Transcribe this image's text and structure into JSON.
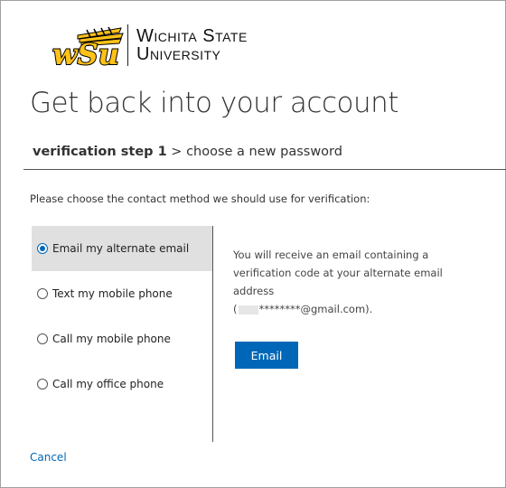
{
  "brand": {
    "logo_mark": "wSu",
    "name_line1": "Wichita State",
    "name_line2": "University",
    "colors": {
      "gold": "#FFC217",
      "black": "#000000"
    }
  },
  "page": {
    "title": "Get back into your account",
    "step_current": "verification step 1",
    "step_separator": " > ",
    "step_next": "choose a new password",
    "prompt": "Please choose the contact method we should use for verification:"
  },
  "options": [
    {
      "label": "Email my alternate email",
      "selected": true
    },
    {
      "label": "Text my mobile phone",
      "selected": false
    },
    {
      "label": "Call my mobile phone",
      "selected": false
    },
    {
      "label": "Call my office phone",
      "selected": false
    }
  ],
  "detail": {
    "line1": "You will receive an email containing a verification code at your alternate email address",
    "email_open": "(",
    "email_masked": "********@gmail.com",
    "email_close": ")."
  },
  "actions": {
    "email_button": "Email",
    "cancel_link": "Cancel"
  },
  "colors": {
    "accent": "#0067b8",
    "selected_bg": "#e0e0e0"
  }
}
